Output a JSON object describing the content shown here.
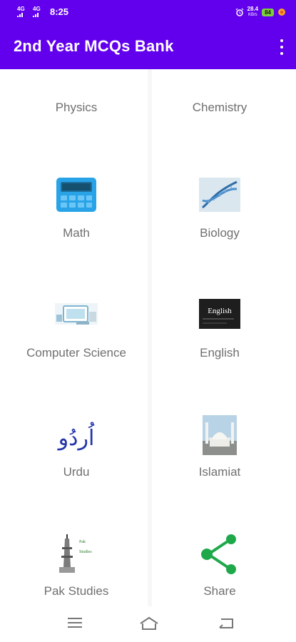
{
  "status": {
    "net1": "4G",
    "net2": "4G",
    "time": "8:25",
    "speed_value": "28.4",
    "speed_unit": "KB/s",
    "battery": "84"
  },
  "app": {
    "title": "2nd Year MCQs Bank"
  },
  "subjects": [
    {
      "label": "Physics",
      "icon": "physics-image"
    },
    {
      "label": "Chemistry",
      "icon": "flask-icon"
    },
    {
      "label": "Math",
      "icon": "calculator-icon"
    },
    {
      "label": "Biology",
      "icon": "dna-image"
    },
    {
      "label": "Computer Science",
      "icon": "computer-icon"
    },
    {
      "label": "English",
      "icon": "english-board-icon"
    },
    {
      "label": "Urdu",
      "icon": "urdu-calligraphy"
    },
    {
      "label": "Islamiat",
      "icon": "mosque-image"
    },
    {
      "label": "Pak Studies",
      "icon": "minar-icon",
      "icon_text_1": "Pak",
      "icon_text_2": "Studies"
    },
    {
      "label": "Share",
      "icon": "share-icon"
    }
  ],
  "english_icon_text": "English",
  "urdu_text": "اُردُو",
  "colors": {
    "primary": "#6200ee",
    "label": "#6f6f6f",
    "share": "#1fa84a"
  }
}
